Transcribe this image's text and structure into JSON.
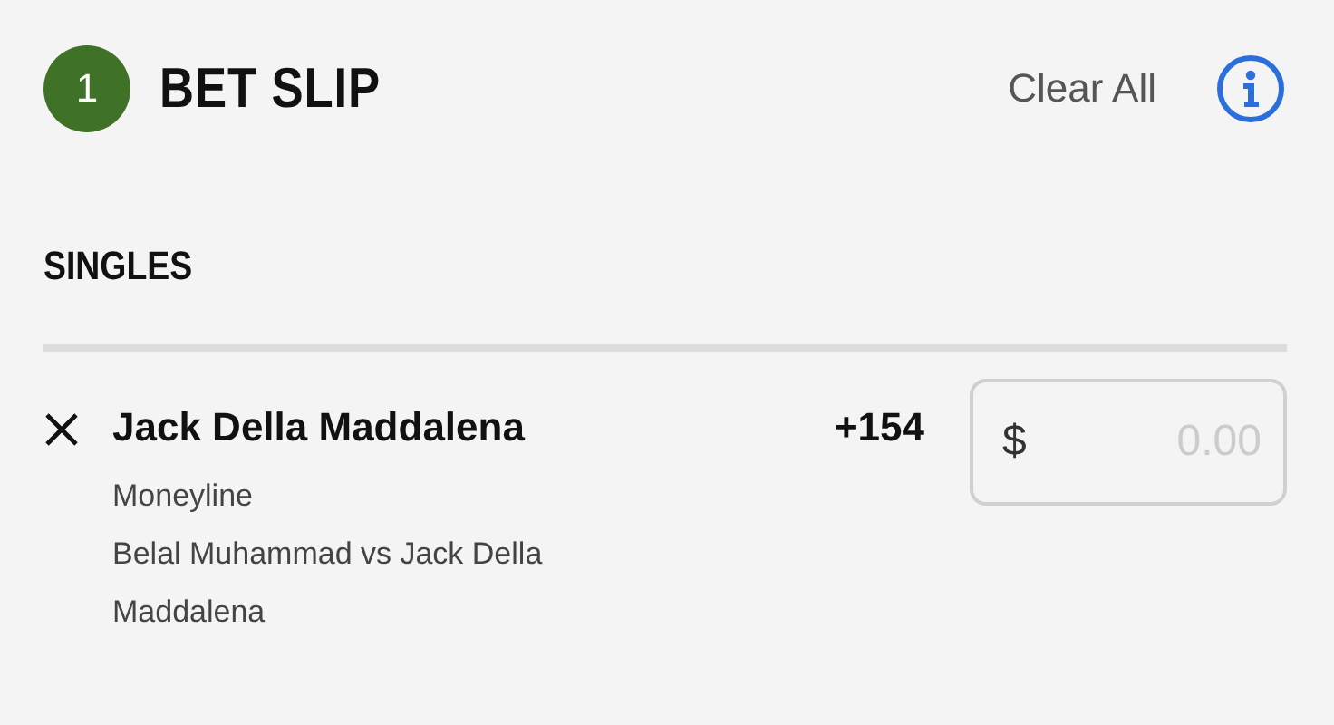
{
  "header": {
    "count": "1",
    "title": "BET SLIP",
    "clear_label": "Clear All"
  },
  "section": {
    "title": "SINGLES"
  },
  "bets": [
    {
      "selection": "Jack Della Maddalena",
      "odds": "+154",
      "market": "Moneyline",
      "event": "Belal Muhammad vs Jack Della Maddalena",
      "stake": {
        "currency": "$",
        "placeholder": "0.00"
      }
    }
  ]
}
